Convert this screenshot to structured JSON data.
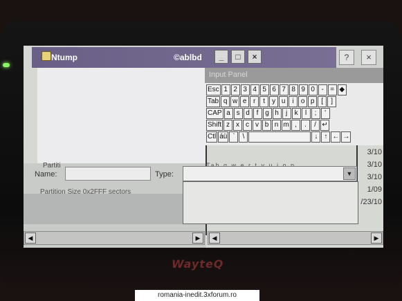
{
  "device": {
    "brand": "WayteQ"
  },
  "watermark": "romania-inedit.3xforum.ro",
  "window": {
    "title": "Ntump",
    "user": "©ablbd",
    "min_label": "_",
    "max_label": "□",
    "close_label": "×",
    "help_label": "?",
    "close2_label": "×"
  },
  "form": {
    "partition_label": "Partiti",
    "name_label": "Name:",
    "name_value": "",
    "type_label": "Type:",
    "type_value": "",
    "type_arrow": "▼",
    "size_text": "Partition Size 0x2FFF sectors"
  },
  "input_panel": {
    "title": "Input Panel",
    "rows": [
      [
        "Esc",
        "1",
        "2",
        "3",
        "4",
        "5",
        "6",
        "7",
        "8",
        "9",
        "0",
        "-",
        "=",
        "◆"
      ],
      [
        "Tab",
        "q",
        "w",
        "e",
        "r",
        "t",
        "y",
        "u",
        "i",
        "o",
        "p",
        "[",
        "]"
      ],
      [
        "CAP",
        "a",
        "s",
        "d",
        "f",
        "g",
        "h",
        "j",
        "k",
        "l",
        ";",
        "'"
      ],
      [
        "Shift",
        "z",
        "x",
        "c",
        "v",
        "b",
        "n",
        "m",
        ",",
        ".",
        "/",
        "↵"
      ],
      [
        "Ctl",
        "áü",
        "`",
        "\\",
        "",
        "↓",
        "↑",
        "←",
        "→"
      ]
    ],
    "ghost_row": "Tab q w e r t y u i o p"
  },
  "dates": [
    "3/10",
    "3/10",
    "3/10",
    "1/09",
    "/23/10"
  ],
  "scroll": {
    "left": "◀",
    "right": "▶"
  }
}
